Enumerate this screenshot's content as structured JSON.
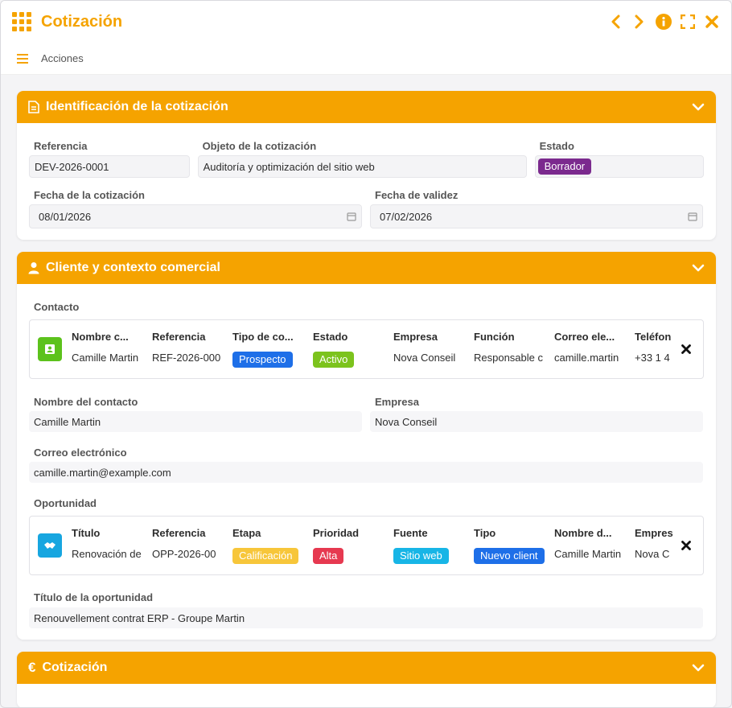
{
  "window": {
    "title": "Cotización",
    "accent": "#f5a300"
  },
  "toolbar": {
    "actions_label": "Acciones"
  },
  "sections": {
    "identificacion": {
      "title": "Identificación de la cotización",
      "referencia": {
        "label": "Referencia",
        "value": "DEV-2026-0001"
      },
      "objeto": {
        "label": "Objeto de la cotización",
        "value": "Auditoría y optimización del sitio web"
      },
      "estado": {
        "label": "Estado",
        "value": "Borrador",
        "color": "#7b2a8e"
      },
      "fecha": {
        "label": "Fecha de la cotización",
        "value": "08/01/2026"
      },
      "validez": {
        "label": "Fecha de validez",
        "value": "07/02/2026"
      }
    },
    "cliente": {
      "title": "Cliente y contexto comercial",
      "contacto_label": "Contacto",
      "contact_card": {
        "columns": [
          "Nombre c...",
          "Referencia",
          "Tipo de co...",
          "Estado",
          "Empresa",
          "Función",
          "Correo ele...",
          "Teléfon"
        ],
        "values": [
          "Camille Martin",
          "REF-2026-000",
          "Prospecto",
          "Activo",
          "Nova Conseil",
          "Responsable c",
          "camille.martin",
          "+33 1 4"
        ],
        "badge_colors": {
          "Prospecto": "#1e6fe8",
          "Activo": "#7cc31d"
        }
      },
      "nombre_contacto": {
        "label": "Nombre del contacto",
        "value": "Camille Martin"
      },
      "empresa": {
        "label": "Empresa",
        "value": "Nova Conseil"
      },
      "correo": {
        "label": "Correo electrónico",
        "value": "camille.martin@example.com"
      },
      "oportunidad_label": "Oportunidad",
      "opp_card": {
        "columns": [
          "Título",
          "Referencia",
          "Etapa",
          "Prioridad",
          "Fuente",
          "Tipo",
          "Nombre d...",
          "Empres"
        ],
        "values": [
          "Renovación de",
          "OPP-2026-00",
          "Calificación",
          "Alta",
          "Sitio web",
          "Nuevo client",
          "Camille Martin",
          "Nova C"
        ],
        "badge_colors": {
          "Calificación": "#f7c63a",
          "Alta": "#e63950",
          "Sitio web": "#17b5e6",
          "Nuevo client": "#1e6fe8"
        }
      },
      "titulo_oportunidad": {
        "label": "Título de la oportunidad",
        "value": "Renouvellement contrat ERP - Groupe Martin"
      }
    },
    "cotizacion": {
      "title": "Cotización"
    }
  }
}
